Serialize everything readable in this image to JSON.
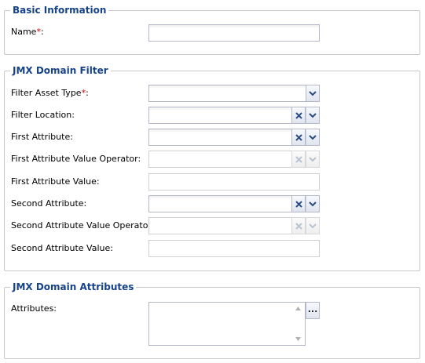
{
  "basic": {
    "legend": "Basic Information",
    "name_label": "Name",
    "required_mark": "*",
    "colon": ":"
  },
  "filter": {
    "legend": "JMX Domain Filter",
    "filter_asset_type_label": "Filter Asset Type",
    "filter_location_label": "Filter Location:",
    "first_attribute_label": "First Attribute:",
    "first_attribute_value_operator_label": "First Attribute Value Operator:",
    "first_attribute_value_label": "First Attribute Value:",
    "second_attribute_label": "Second Attribute:",
    "second_attribute_value_operator_label": "Second Attribute Value Operator:",
    "second_attribute_value_label": "Second Attribute Value:"
  },
  "attributes": {
    "legend": "JMX Domain Attributes",
    "attributes_label": "Attributes:",
    "ellipsis_label": "..."
  },
  "icons": {
    "dropdown": "chevron-down-icon",
    "clear": "clear-x-icon",
    "scroll_up": "scroll-up-arrow-icon",
    "scroll_down": "scroll-down-arrow-icon"
  },
  "colors": {
    "legend_text": "#15428b",
    "required": "#cc0000",
    "trigger_icon": "#2b4c80"
  }
}
